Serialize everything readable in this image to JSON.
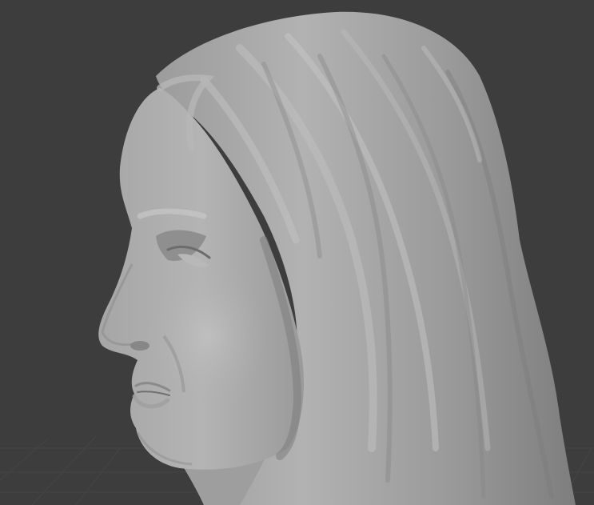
{
  "app": {
    "type": "3d-sculpt-viewport"
  },
  "viewport": {
    "background_color": "#3d3d3d",
    "grid_color": "#4a4a4a",
    "model": {
      "subject": "sculpted-female-head-with-long-hair",
      "material": "matcap-clay",
      "base_color": "#a8a8a8"
    }
  }
}
